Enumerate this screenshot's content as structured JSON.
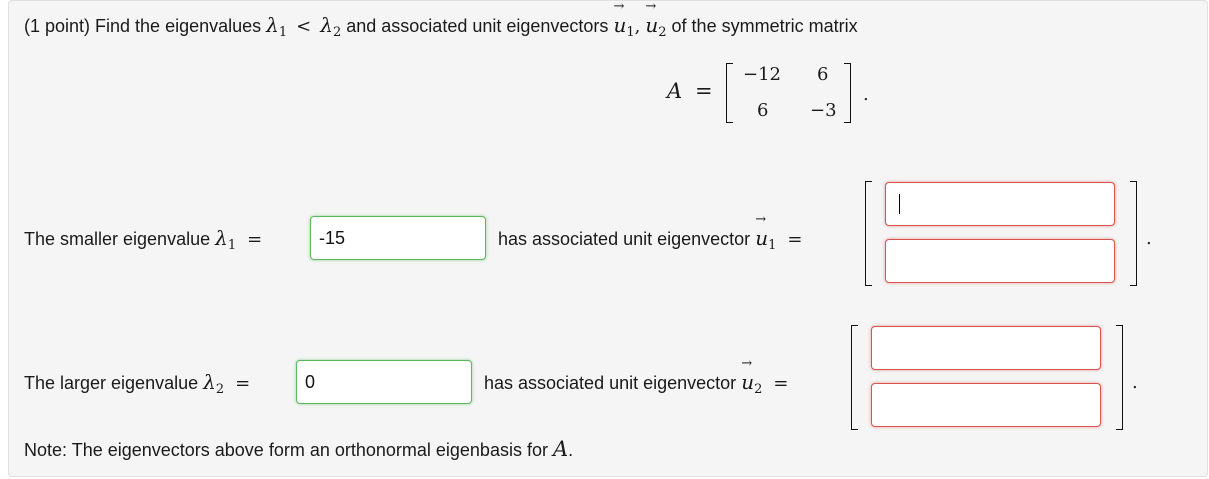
{
  "question": {
    "prefix": "(1 point) Find the eigenvalues",
    "l1": "λ",
    "l1sub": "1",
    "lt": "<",
    "l2": "λ",
    "l2sub": "2",
    "mid": "and associated unit eigenvectors",
    "u1": "u",
    "u1sub": "1",
    "comma": ",",
    "u2": "u",
    "u2sub": "2",
    "suffix": "of the symmetric matrix"
  },
  "matrix": {
    "name": "A",
    "eq": "=",
    "cells": [
      "−12",
      "6",
      "6",
      "−3"
    ],
    "period": "."
  },
  "row1": {
    "label": "The smaller eigenvalue",
    "sym": "λ",
    "symsub": "1",
    "eq": "=",
    "eigenvalue": "-15",
    "vec_label": "has associated unit eigenvector",
    "vsym": "u",
    "vsub": "1",
    "veq": "=",
    "v_top": "",
    "v_bottom": "",
    "period": "."
  },
  "row2": {
    "label": "The larger eigenvalue",
    "sym": "λ",
    "symsub": "2",
    "eq": "=",
    "eigenvalue": "0",
    "vec_label": "has associated unit eigenvector",
    "vsym": "u",
    "vsub": "2",
    "veq": "=",
    "v_top": "",
    "v_bottom": "",
    "period": "."
  },
  "note": {
    "text": "Note: The eigenvectors above form an orthonormal eigenbasis for",
    "sym": "A",
    "period": "."
  },
  "colors": {
    "panel_bg": "#f5f5f5",
    "correct_border": "#5cb85c",
    "incorrect_border": "#d9534f"
  }
}
